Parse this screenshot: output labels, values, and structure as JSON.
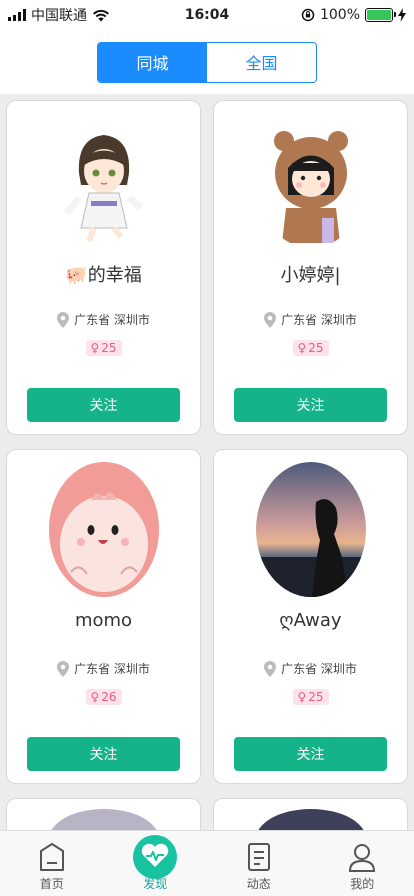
{
  "status_bar": {
    "carrier": "中国联通",
    "time": "16:04",
    "battery": "100%"
  },
  "segment": {
    "tabs": [
      {
        "label": "同城",
        "active": true
      },
      {
        "label": "全国",
        "active": false
      }
    ]
  },
  "colors": {
    "accent_blue": "#1a8cff",
    "follow_green": "#14b389",
    "age_pink": "#e45d86",
    "tab_active": "#1aa49b"
  },
  "cards": [
    {
      "name": "🐖的幸福",
      "location": "广东省 深圳市",
      "age": "25",
      "gender_icon": "female-icon",
      "follow_label": "关注",
      "avatar": "anime-girl-avatar"
    },
    {
      "name": "小婷婷|",
      "location": "广东省 深圳市",
      "age": "25",
      "gender_icon": "female-icon",
      "follow_label": "关注",
      "avatar": "bear-hood-girl-avatar"
    },
    {
      "name": "momo",
      "location": "广东省 深圳市",
      "age": "26",
      "gender_icon": "female-icon",
      "follow_label": "关注",
      "avatar": "pink-blob-avatar"
    },
    {
      "name": "ღAway",
      "location": "广东省 深圳市",
      "age": "25",
      "gender_icon": "female-icon",
      "follow_label": "关注",
      "avatar": "sunset-silhouette-avatar"
    }
  ],
  "tab_bar": {
    "items": [
      {
        "label": "首页",
        "icon": "home-icon",
        "active": false
      },
      {
        "label": "发现",
        "icon": "heartbeat-icon",
        "active": true
      },
      {
        "label": "动态",
        "icon": "document-icon",
        "active": false
      },
      {
        "label": "我的",
        "icon": "user-icon",
        "active": false
      }
    ]
  }
}
